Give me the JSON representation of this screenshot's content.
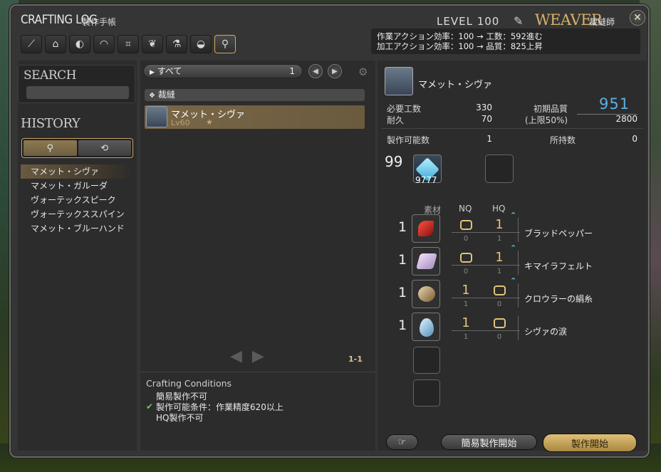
{
  "window": {
    "title": "CRAFTING LOG",
    "title_sub": "製作手帳",
    "level_label": "LEVEL",
    "level_value": "100",
    "job_name": "WEAVER",
    "job_sub": "裁縫師"
  },
  "tabs": [
    {
      "icon": "carpenter-saw-icon"
    },
    {
      "icon": "anvil-icon"
    },
    {
      "icon": "armorer-helmet-icon"
    },
    {
      "icon": "goldsmith-icon"
    },
    {
      "icon": "loom-icon"
    },
    {
      "icon": "leaf-icon"
    },
    {
      "icon": "alchemy-flask-icon"
    },
    {
      "icon": "cooking-pot-icon"
    },
    {
      "icon": "search-icon"
    }
  ],
  "efficiency": {
    "line1": "作業アクション効率：100 → 工数：592進む",
    "line2": "加工アクション効率：100 → 品質：825上昇"
  },
  "left": {
    "search_label": "SEARCH",
    "history_label": "HISTORY",
    "history": [
      "マメット・シヴァ",
      "マメット・ガルーダ",
      "ヴォーテックスピーク",
      "ヴォーテックススパイン",
      "マメット・ブルーハンド"
    ]
  },
  "middle": {
    "filter_label": "すべて",
    "filter_count": "1",
    "category": "裁縫",
    "recipe_name": "マメット・シヴァ",
    "recipe_level": "Lv60",
    "recipe_star": "★",
    "page": "1-1",
    "conditions_title": "Crafting Conditions",
    "conditions": [
      "簡易製作不可",
      "製作可能条件：作業精度620以上",
      "HQ製作不可"
    ]
  },
  "right": {
    "item_name": "マメット・シヴァ",
    "required_progress_label": "必要工数",
    "required_progress": "330",
    "durability_label": "耐久",
    "durability": "70",
    "initial_quality_label": "初期品質",
    "initial_quality": "951",
    "cap_label": "(上限50%)",
    "cap_value": "2800",
    "craftable_label": "製作可能数",
    "craftable": "1",
    "owned_label": "所持数",
    "owned": "0",
    "crystal_qty": "99",
    "crystal_owned": "9777",
    "materials_header": "素材",
    "nq_header": "NQ",
    "hq_header": "HQ",
    "materials": [
      {
        "qty": "1",
        "name": "ブラッドペッパー",
        "nq": "0",
        "hq": "1",
        "nq_small": "0",
        "hq_small": "1",
        "icon": "red-pepper-icon"
      },
      {
        "qty": "1",
        "name": "キマイラフェルト",
        "nq": "0",
        "hq": "1",
        "nq_small": "0",
        "hq_small": "1",
        "icon": "felt-cloth-icon"
      },
      {
        "qty": "1",
        "name": "クロウラーの絹糸",
        "nq": "1",
        "hq": "0",
        "nq_small": "1",
        "hq_small": "0",
        "icon": "silk-cocoon-icon"
      },
      {
        "qty": "1",
        "name": "シヴァの涙",
        "nq": "1",
        "hq": "0",
        "nq_small": "1",
        "hq_small": "0",
        "icon": "ice-tear-icon"
      }
    ],
    "quick_synth_label": "簡易製作開始",
    "synth_label": "製作開始"
  }
}
